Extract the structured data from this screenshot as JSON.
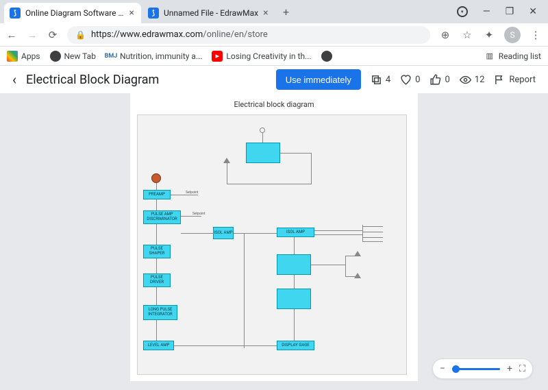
{
  "browser": {
    "tabs": [
      {
        "title": "Online Diagram Software - EdrawM...",
        "active": true
      },
      {
        "title": "Unnamed File - EdrawMax",
        "active": false
      }
    ],
    "url_host": "https://www.edrawmax.com",
    "url_path": "/online/en/store",
    "avatar_initial": "S",
    "reading_list": "Reading list",
    "bookmarks": [
      {
        "icon": "apps",
        "label": "Apps"
      },
      {
        "icon": "globe-dark",
        "label": "New Tab"
      },
      {
        "icon": "bmj",
        "label": "Nutrition, immunity a..."
      },
      {
        "icon": "yt",
        "label": "Losing Creativity in th..."
      },
      {
        "icon": "globe-dark",
        "label": ""
      }
    ]
  },
  "page": {
    "title": "Electrical Block Diagram",
    "use_button": "Use immediately",
    "stats": {
      "copies": "4",
      "likes": "0",
      "thumbs": "0",
      "views": "12"
    },
    "report": "Report",
    "doc_title": "Electrical block diagram"
  },
  "diagram": {
    "blocks": {
      "preamp": "PREAMP",
      "setpoint": "Setpoint",
      "pulse_amp_disc": "PULSE AMP DISCRIMINATOR",
      "isol_amp": "ISOL AMP",
      "isol_amp2": "ISOL AMP",
      "pulse_shaper": "PULSE SHAPER",
      "pulse_driver": "PULSE DRIVER",
      "long_pulse_int": "LONG PULSE INTEGRATOR",
      "level_amp": "LEVEL AMP",
      "display_gage": "DISPLAY GAGE"
    }
  }
}
